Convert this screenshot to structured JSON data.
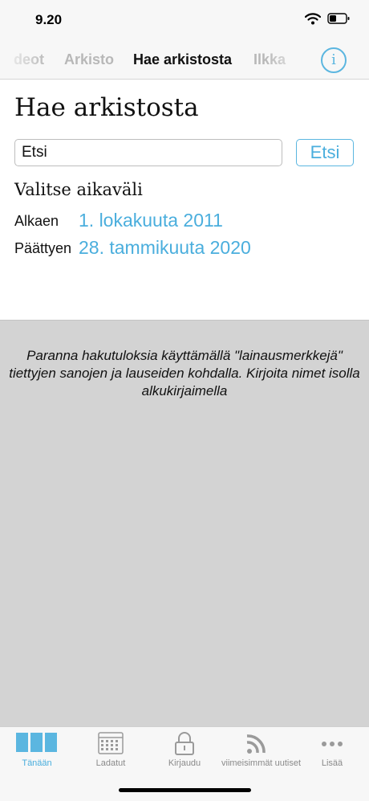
{
  "status": {
    "time": "9.20"
  },
  "nav": {
    "tabs": [
      {
        "label": "deot",
        "active": false
      },
      {
        "label": "Arkisto",
        "active": false
      },
      {
        "label": "Hae arkistosta",
        "active": true
      },
      {
        "label": "Ilkka",
        "active": false
      }
    ],
    "info_glyph": "i"
  },
  "search": {
    "title": "Hae arkistosta",
    "input_value": "Etsi",
    "button_label": "Etsi",
    "range_heading": "Valitse aikaväli",
    "start_label": "Alkaen",
    "start_value": "1. lokakuuta 2011",
    "end_label": "Päättyen",
    "end_value": "28. tammikuuta 2020"
  },
  "hint": "Paranna hakutuloksia käyttämällä \"lainausmerkkejä\" tiettyjen sanojen ja lauseiden kohdalla. Kirjoita nimet isolla alkukirjaimella",
  "tabbar": {
    "items": [
      {
        "label": "Tänään",
        "icon": "today-icon",
        "active": true
      },
      {
        "label": "Ladatut",
        "icon": "calendar-icon",
        "active": false
      },
      {
        "label": "Kirjaudu",
        "icon": "lock-icon",
        "active": false
      },
      {
        "label": "viimeisimmät uutiset",
        "icon": "rss-icon",
        "active": false
      },
      {
        "label": "Lisää",
        "icon": "more-icon",
        "active": false
      }
    ]
  },
  "colors": {
    "accent": "#4aaedd",
    "hint_background": "#d3d3d3",
    "bar_background": "#f7f7f7"
  }
}
